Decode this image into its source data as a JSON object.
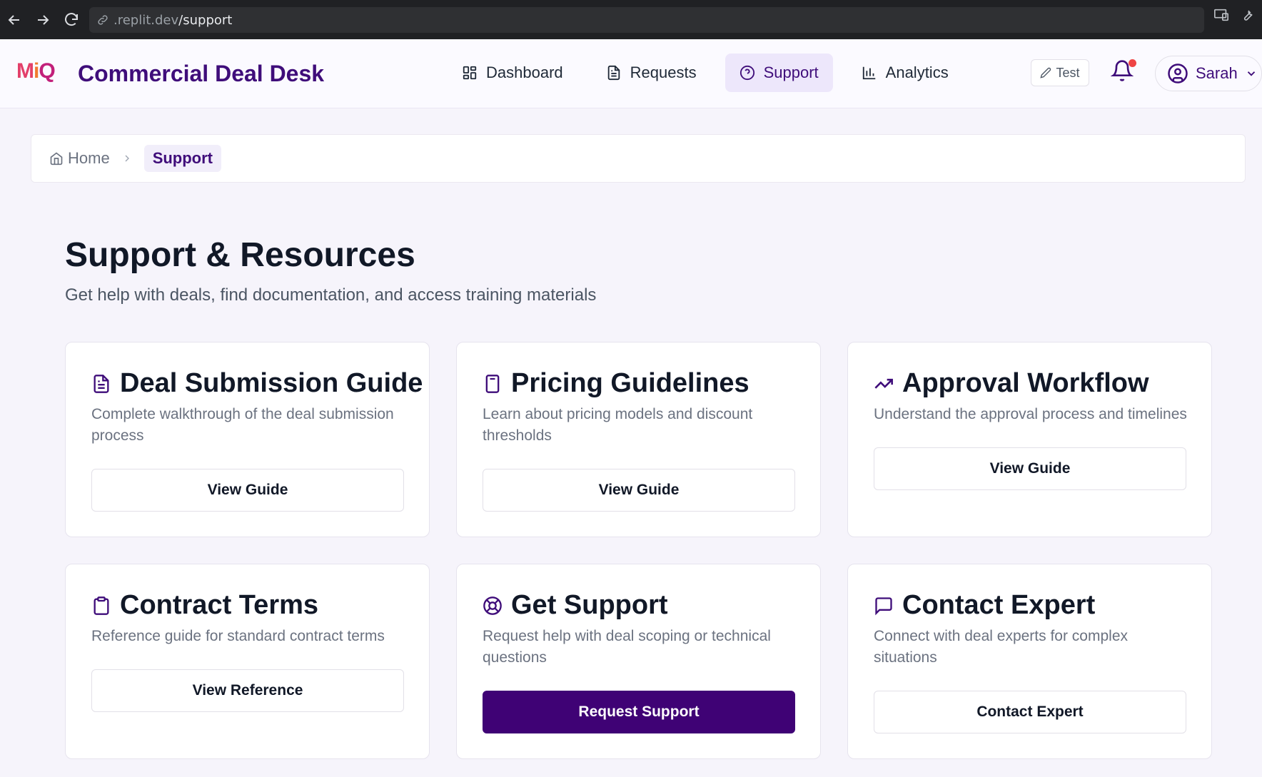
{
  "browser": {
    "url_dim": ".replit.dev",
    "url_path": "/support"
  },
  "header": {
    "app_title": "Commercial Deal Desk",
    "logo": {
      "m": "M",
      "i": "i",
      "q": "Q"
    },
    "nav": [
      {
        "label": "Dashboard",
        "icon": "grid-icon"
      },
      {
        "label": "Requests",
        "icon": "document-icon"
      },
      {
        "label": "Support",
        "icon": "help-circle-icon",
        "active": true
      },
      {
        "label": "Analytics",
        "icon": "bar-chart-icon"
      }
    ],
    "test_label": "Test",
    "user_name": "Sarah",
    "accent": "#3f0d7a"
  },
  "breadcrumb": {
    "home": "Home",
    "current": "Support"
  },
  "page": {
    "title": "Support & Resources",
    "subtitle": "Get help with deals, find documentation, and access training materials"
  },
  "cards": [
    {
      "title": "Deal Submission Guide",
      "description": "Complete walkthrough of the deal submission process",
      "button": "View Guide",
      "icon": "file-text-icon"
    },
    {
      "title": "Pricing Guidelines",
      "description": "Learn about pricing models and discount thresholds",
      "button": "View Guide",
      "icon": "calculator-icon"
    },
    {
      "title": "Approval Workflow",
      "description": "Understand the approval process and timelines",
      "button": "View Guide",
      "icon": "trending-up-icon"
    },
    {
      "title": "Contract Terms",
      "description": "Reference guide for standard contract terms",
      "button": "View Reference",
      "icon": "clipboard-icon"
    },
    {
      "title": "Get Support",
      "description": "Request help with deal scoping or technical questions",
      "button": "Request Support",
      "icon": "life-buoy-icon",
      "primary": true
    },
    {
      "title": "Contact Expert",
      "description": "Connect with deal experts for complex situations",
      "button": "Contact Expert",
      "icon": "message-square-icon"
    }
  ]
}
